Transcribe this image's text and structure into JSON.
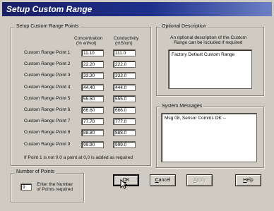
{
  "window": {
    "title": "Setup Custom Range"
  },
  "points_group": {
    "title": "Setup Custom Range Points",
    "col_conc": [
      "Concentration",
      "(% wt/vol)"
    ],
    "col_cond": [
      "Conductivity",
      "(mS/cm)"
    ],
    "rows": [
      {
        "label": "Custom Range Point 1",
        "conc": "11.10",
        "cond": "111.0"
      },
      {
        "label": "Custom Range Point 2",
        "conc": "22.20",
        "cond": "222.0"
      },
      {
        "label": "Custom Range Point 3",
        "conc": "33.30",
        "cond": "333.0"
      },
      {
        "label": "Custom Range Point 4",
        "conc": "44.40",
        "cond": "444.0"
      },
      {
        "label": "Custom Range Point 5",
        "conc": "55.50",
        "cond": "555.0"
      },
      {
        "label": "Custom Range Point 6",
        "conc": "66.60",
        "cond": "666.0"
      },
      {
        "label": "Custom Range Point 7",
        "conc": "77.70",
        "cond": "777.0"
      },
      {
        "label": "Custom Range Point 8",
        "conc": "88.80",
        "cond": "888.0"
      },
      {
        "label": "Custom Range Point 9",
        "conc": "99.90",
        "cond": "999.0"
      }
    ],
    "note": "If Point 1 is not 0,0 a point at 0,0 is added as required"
  },
  "points_count": {
    "title": "Number of Points",
    "value": "9",
    "hint": [
      "Enter the Number",
      "of Points required"
    ]
  },
  "optional_desc": {
    "title": "Optional Description",
    "hint": [
      "An optional description of the Custom",
      "Range can be included if required"
    ],
    "value": "Factory Default Custom Range"
  },
  "system_messages": {
    "title": "System Messages",
    "text": "Msg 08, Sensor Comms OK  --"
  },
  "buttons": {
    "ok": {
      "pre": "",
      "u": "O",
      "post": "K"
    },
    "cancel": {
      "pre": "",
      "u": "C",
      "post": "ancel"
    },
    "apply": {
      "pre": "",
      "u": "A",
      "post": "pply"
    },
    "help": {
      "pre": "",
      "u": "H",
      "post": "elp"
    }
  }
}
